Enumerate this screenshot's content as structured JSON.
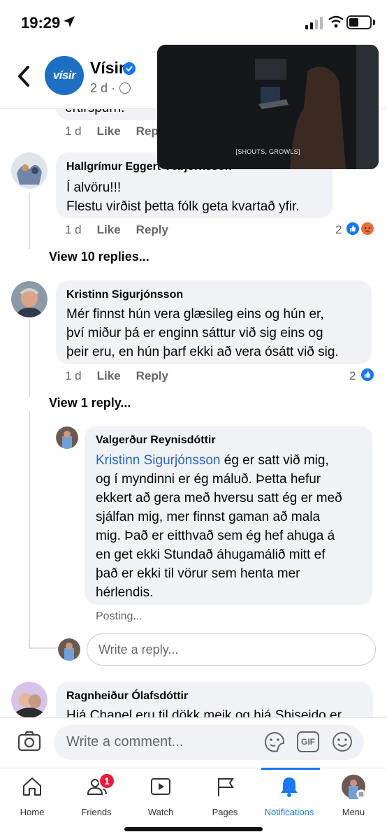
{
  "status_bar": {
    "time": "19:29"
  },
  "header": {
    "page_name": "Vísir",
    "avatar_text": "vísir",
    "meta": "2 d ·"
  },
  "video_pip": {
    "caption": "[SHOUTS, GROWLS]"
  },
  "top_comment": {
    "text_fragment": "ertirspurn.",
    "time": "1 d",
    "like": "Like",
    "reply": "Reply"
  },
  "comments": [
    {
      "author": "Hallgrímur Eggert Vébjörnsson",
      "lines": [
        "Í alvöru!!!",
        "Flestu virðist þetta fólk geta kvartað yfir."
      ],
      "time": "1 d",
      "like": "Like",
      "reply": "Reply",
      "reactions": "2",
      "view_replies": "View 10 replies..."
    },
    {
      "author": "Kristinn Sigurjónsson",
      "lines": [
        "Mér finnst hún vera glæsileg eins og hún er,",
        "því miður þá er enginn sáttur við sig eins og",
        "þeir eru, en hún þarf ekki að vera ósátt við sig."
      ],
      "time": "1 d",
      "like": "Like",
      "reply": "Reply",
      "reactions": "2",
      "view_replies": "View 1 reply..."
    }
  ],
  "reply": {
    "author": "Valgerður Reynisdóttir",
    "mention": "Kristinn Sigurjónsson",
    "first_line_rest": " ég er satt við mig,",
    "lines": [
      "og í myndinni er ég máluð. Þetta hefur",
      "ekkert að gera með hversu satt ég er með",
      "sjálfan mig, mer finnst gaman að mala",
      "mig. Það er eitthvað sem ég hef ahuga á",
      "en get ekki Stundað áhugamálið mitt ef",
      "það er ekki til vörur sem henta mer",
      "hérlendis."
    ],
    "status": "Posting..."
  },
  "reply_box": {
    "placeholder": "Write a reply..."
  },
  "next_comment": {
    "author": "Ragnheiður Ólafsdóttir",
    "text_fragment": "Hjá Chanel eru til dökk meik og hjá Shiseido er"
  },
  "composer": {
    "placeholder": "Write a comment...",
    "gif": "GIF"
  },
  "tabs": [
    {
      "label": "Home",
      "icon": "home-icon"
    },
    {
      "label": "Friends",
      "icon": "friends-icon",
      "badge": "1"
    },
    {
      "label": "Watch",
      "icon": "watch-icon"
    },
    {
      "label": "Pages",
      "icon": "flag-icon"
    },
    {
      "label": "Notifications",
      "icon": "bell-icon",
      "active": true
    },
    {
      "label": "Menu",
      "icon": "profile-avatar"
    }
  ],
  "colors": {
    "accent": "#1877f2",
    "bubble": "#f0f2f5",
    "mention": "#2d65c0",
    "badge": "#e41e3f"
  }
}
